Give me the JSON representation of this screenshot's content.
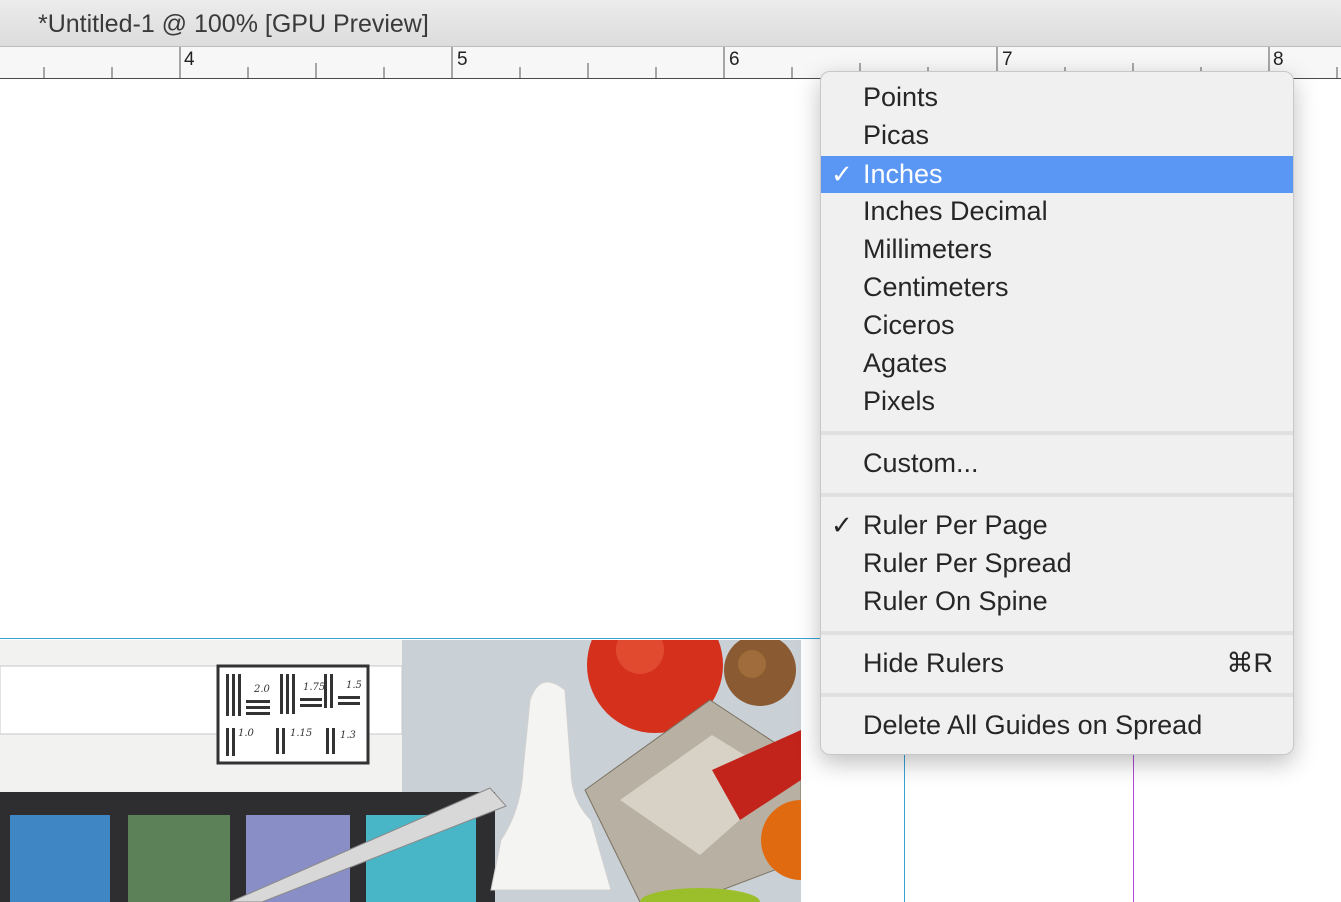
{
  "window": {
    "title": "*Untitled-1 @ 100% [GPU Preview]"
  },
  "ruler": {
    "labels": [
      "4",
      "5",
      "6",
      "7",
      "8"
    ]
  },
  "menu": {
    "items": [
      {
        "label": "Points",
        "checked": false,
        "selected": false
      },
      {
        "label": "Picas",
        "checked": false,
        "selected": false
      },
      {
        "label": "Inches",
        "checked": true,
        "selected": true
      },
      {
        "label": "Inches Decimal",
        "checked": false,
        "selected": false
      },
      {
        "label": "Millimeters",
        "checked": false,
        "selected": false
      },
      {
        "label": "Centimeters",
        "checked": false,
        "selected": false
      },
      {
        "label": "Ciceros",
        "checked": false,
        "selected": false
      },
      {
        "label": "Agates",
        "checked": false,
        "selected": false
      },
      {
        "label": "Pixels",
        "checked": false,
        "selected": false
      },
      {
        "label": "Custom...",
        "checked": false,
        "selected": false
      },
      {
        "label": "Ruler Per Page",
        "checked": true,
        "selected": false
      },
      {
        "label": "Ruler Per Spread",
        "checked": false,
        "selected": false
      },
      {
        "label": "Ruler On Spine",
        "checked": false,
        "selected": false
      },
      {
        "label": "Hide Rulers",
        "shortcut": "⌘R",
        "checked": false,
        "selected": false
      },
      {
        "label": "Delete All Guides on Spread",
        "checked": false,
        "selected": false
      }
    ],
    "check_glyph": "✓"
  },
  "photo": {
    "resolution_marks": [
      "2.0",
      "1.75",
      "1.5",
      "1.0",
      "1.15",
      "1.3"
    ]
  },
  "colors": {
    "highlight": "#5a97f5",
    "guide_cyan": "#39a3d6",
    "guide_magenta": "#b04ad6"
  }
}
